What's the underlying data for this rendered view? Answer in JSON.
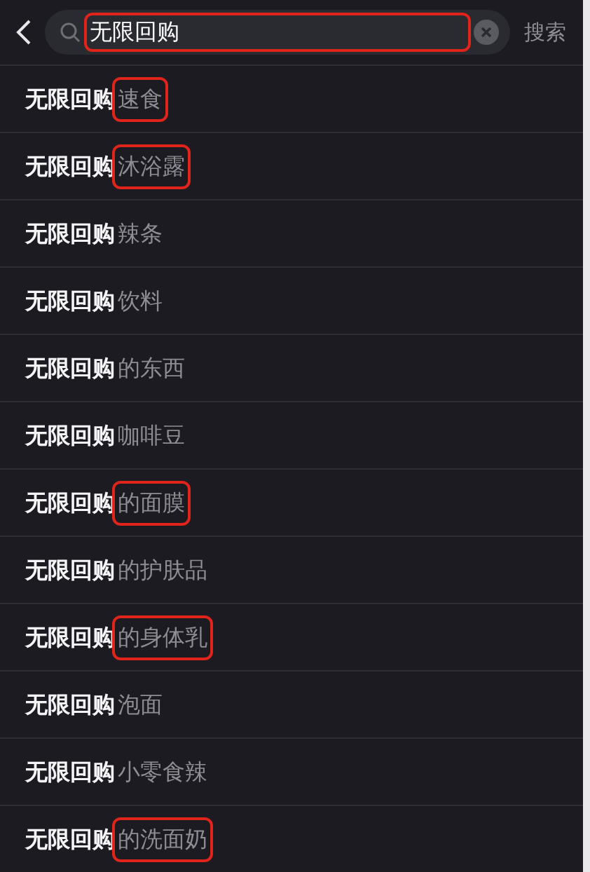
{
  "search": {
    "value": "无限回购",
    "highlighted": true,
    "action": "搜索"
  },
  "suggestions": [
    {
      "prefix": "无限回购",
      "suffix": "速食",
      "highlighted": true
    },
    {
      "prefix": "无限回购",
      "suffix": "沐浴露",
      "highlighted": true
    },
    {
      "prefix": "无限回购",
      "suffix": "辣条",
      "highlighted": false
    },
    {
      "prefix": "无限回购",
      "suffix": "饮料",
      "highlighted": false
    },
    {
      "prefix": "无限回购",
      "suffix": "的东西",
      "highlighted": false
    },
    {
      "prefix": "无限回购",
      "suffix": "咖啡豆",
      "highlighted": false
    },
    {
      "prefix": "无限回购",
      "suffix": "的面膜",
      "highlighted": true
    },
    {
      "prefix": "无限回购",
      "suffix": "的护肤品",
      "highlighted": false
    },
    {
      "prefix": "无限回购",
      "suffix": "的身体乳",
      "highlighted": true
    },
    {
      "prefix": "无限回购",
      "suffix": "泡面",
      "highlighted": false
    },
    {
      "prefix": "无限回购",
      "suffix": "小零食辣",
      "highlighted": false
    },
    {
      "prefix": "无限回购",
      "suffix": "的洗面奶",
      "highlighted": true
    }
  ]
}
